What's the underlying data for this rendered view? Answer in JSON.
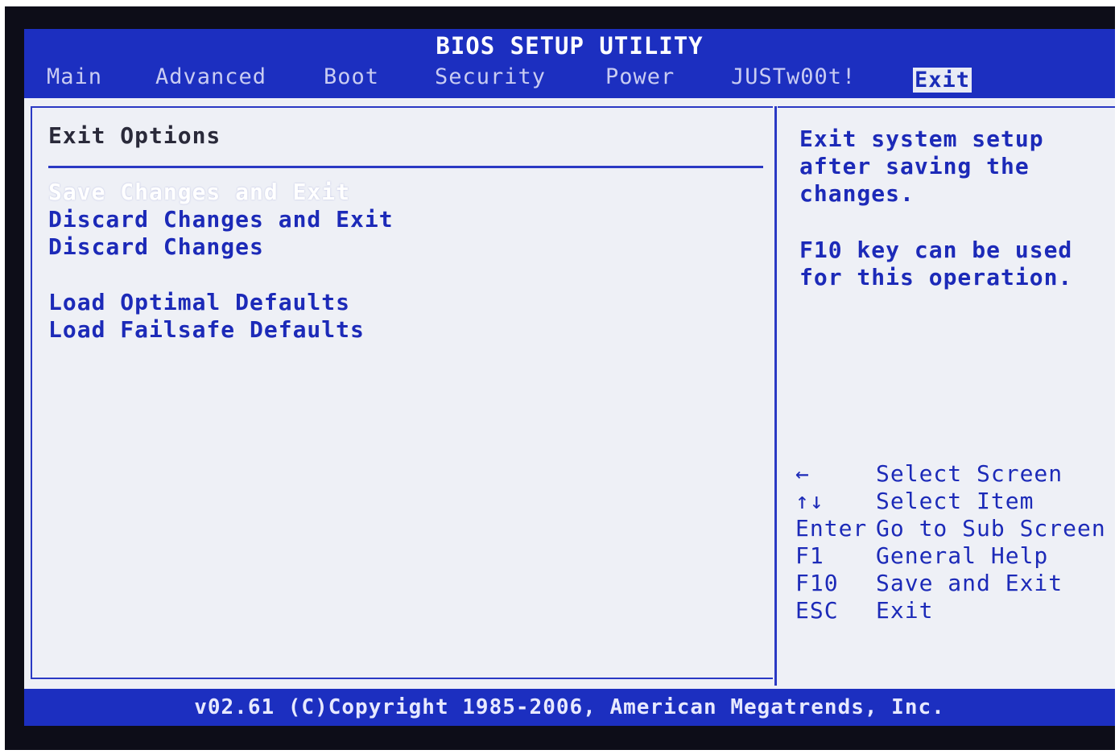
{
  "title": "BIOS SETUP UTILITY",
  "tabs": [
    "Main",
    "Advanced",
    "Boot",
    "Security",
    "Power",
    "JUSTw00t!",
    "Exit"
  ],
  "active_tab": "Exit",
  "section_title": "Exit Options",
  "options": [
    "Save Changes and Exit",
    "Discard Changes and Exit",
    "Discard Changes",
    "Load Optimal Defaults",
    "Load Failsafe Defaults"
  ],
  "selected_option": "Save Changes and Exit",
  "help": {
    "line1": "Exit system setup",
    "line2": "after saving the",
    "line3": "changes.",
    "line4": "F10 key can be used",
    "line5": "for this operation."
  },
  "keys": [
    {
      "key": "←",
      "action": "Select Screen"
    },
    {
      "key": "↑↓",
      "action": "Select Item"
    },
    {
      "key": "Enter",
      "action": "Go to Sub Screen"
    },
    {
      "key": "F1",
      "action": "General Help"
    },
    {
      "key": "F10",
      "action": "Save and Exit"
    },
    {
      "key": "ESC",
      "action": "Exit"
    }
  ],
  "copyright": "v02.61 (C)Copyright 1985-2006, American Megatrends, Inc.",
  "colors": {
    "bar_blue": "#1c2fc0",
    "panel_bg": "#eef0f6",
    "text_blue": "#1c2ab8"
  }
}
